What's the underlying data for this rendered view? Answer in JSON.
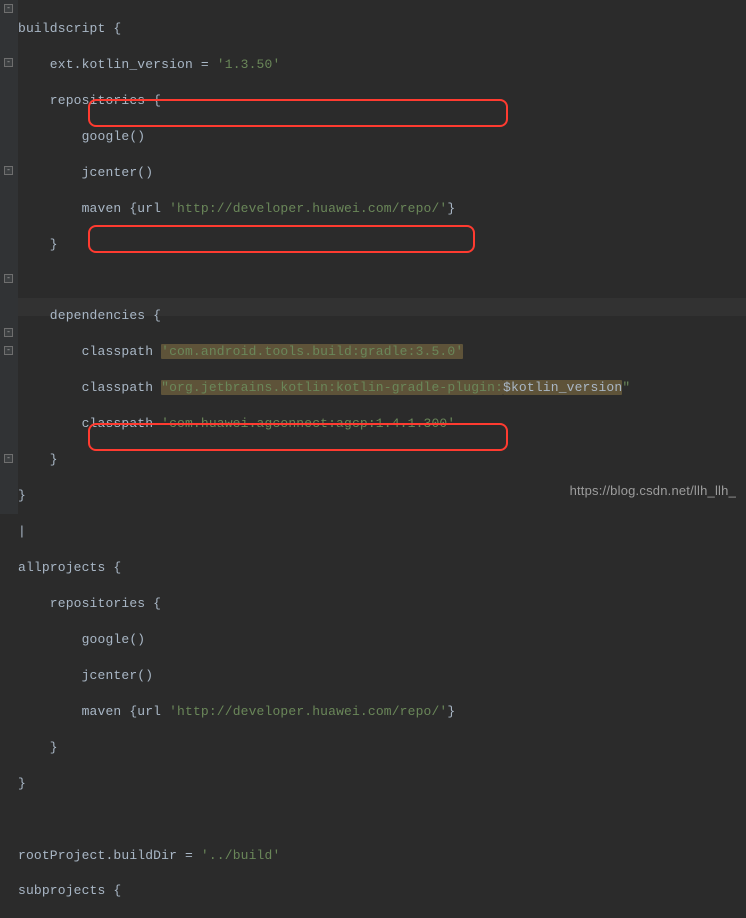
{
  "code": {
    "l1_a": "buildscript {",
    "l2_a": "    ext.kotlin_version = ",
    "l2_s": "'1.3.50'",
    "l3_a": "    repositories {",
    "l4_a": "        google()",
    "l5_a": "        jcenter()",
    "l6_a": "        maven {",
    "l6_b": "url ",
    "l6_s": "'http://developer.huawei.com/repo/'",
    "l6_c": "}",
    "l7_a": "    }",
    "l8_a": "",
    "l9_a": "    dependencies {",
    "l10_a": "        classpath ",
    "l10_s": "'com.android.tools.build:gradle:3.5.0'",
    "l11_a": "        classpath ",
    "l11_s1": "\"org.jetbrains.kotlin:kotlin-gradle-plugin:",
    "l11_v": "$kotlin_version",
    "l11_s2": "\"",
    "l12_a": "        classpath ",
    "l12_s": "'com.huawei.agconnect:agcp:1.4.1.300'",
    "l13_a": "    }",
    "l14_a": "}",
    "l15_a": "|",
    "l16_a": "allprojects {",
    "l17_a": "    repositories {",
    "l18_a": "        google()",
    "l19_a": "        jcenter()",
    "l20_a": "        maven {",
    "l20_b": "url ",
    "l20_s": "'http://developer.huawei.com/repo/'",
    "l20_c": "}",
    "l21_a": "    }",
    "l22_a": "}",
    "l23_a": "",
    "l24_a": "rootProject.buildDir = ",
    "l24_s": "'../build'",
    "l25_a": "subprojects {"
  },
  "watermark": "https://blog.csdn.net/llh_llh_"
}
